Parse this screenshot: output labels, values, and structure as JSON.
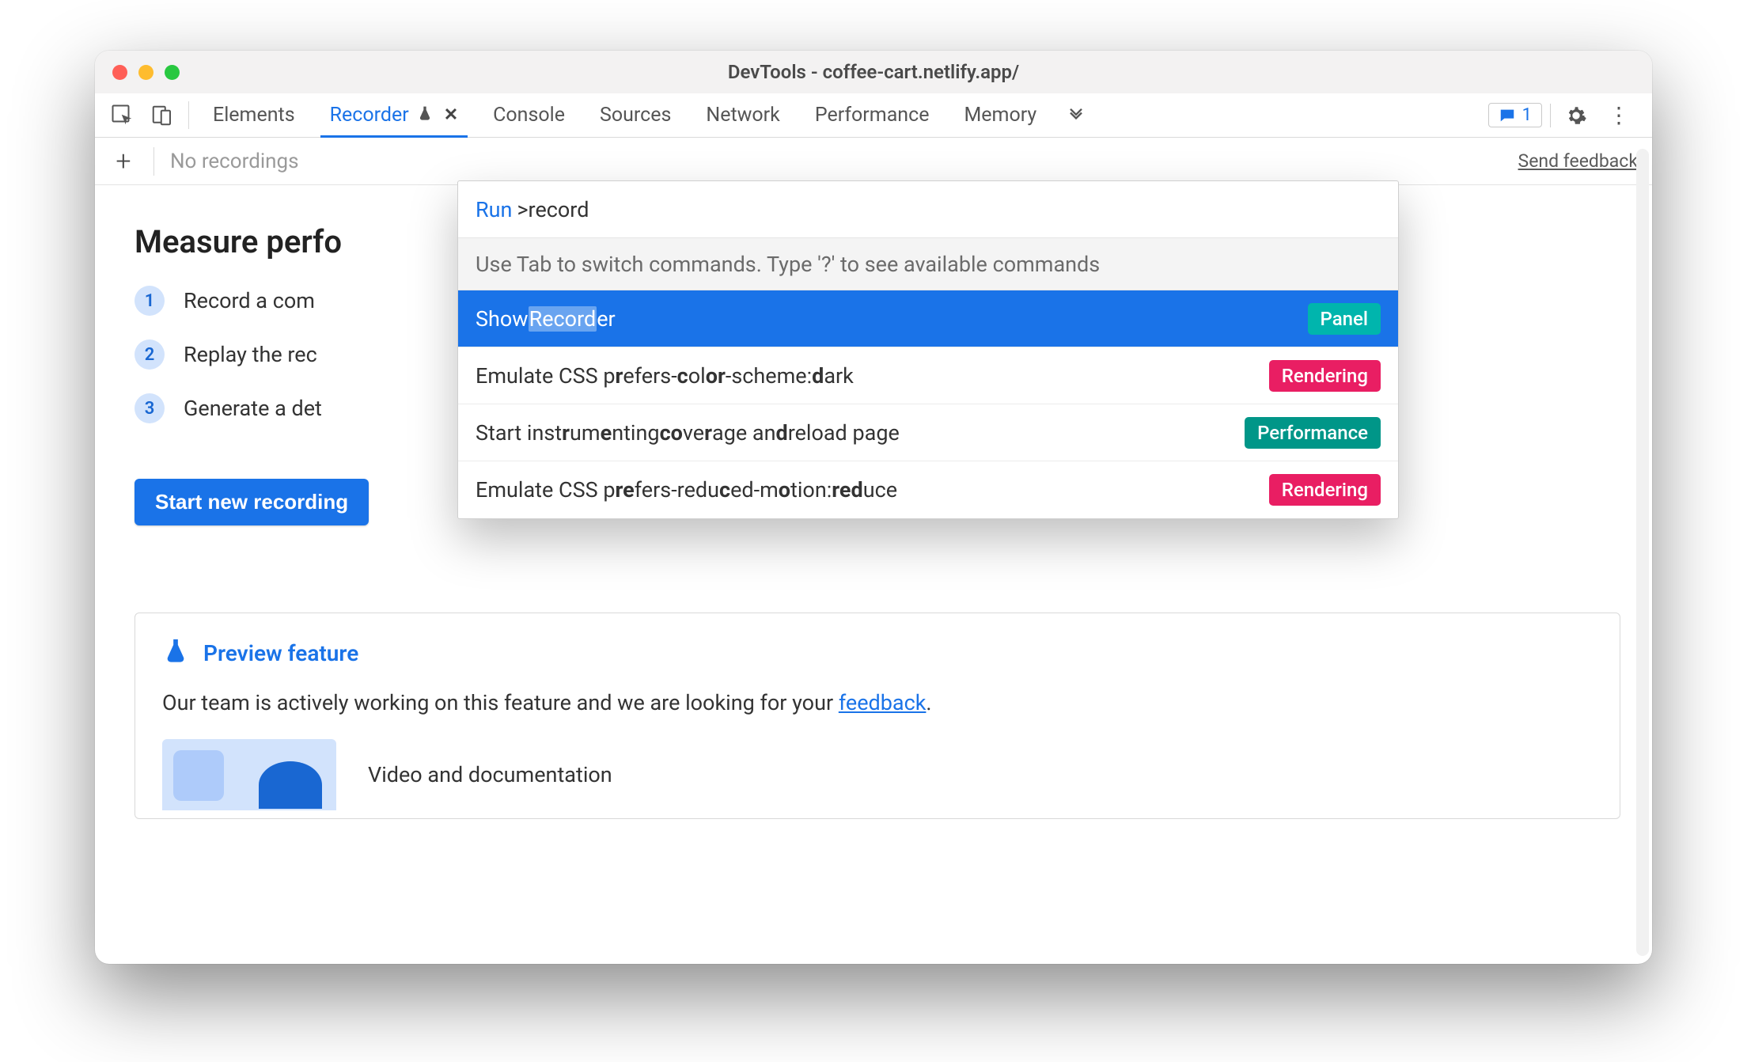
{
  "window": {
    "title": "DevTools - coffee-cart.netlify.app/"
  },
  "tabs": {
    "items": [
      "Elements",
      "Recorder",
      "Console",
      "Sources",
      "Network",
      "Performance",
      "Memory"
    ],
    "active_index": 1,
    "messages_count": "1"
  },
  "subbar": {
    "placeholder": "No recordings",
    "feedback_label": "Send feedback"
  },
  "content": {
    "heading_visible": "Measure perfo",
    "steps_visible": [
      "Record a com",
      "Replay the rec",
      "Generate a det"
    ],
    "start_button": "Start new recording"
  },
  "preview": {
    "title": "Preview feature",
    "body_prefix": "Our team is actively working on this feature and we are looking for your ",
    "body_link": "feedback",
    "body_suffix": ".",
    "media_title": "Video and documentation"
  },
  "palette": {
    "run_label": "Run",
    "query": ">record",
    "hint": "Use Tab to switch commands. Type '?' to see available commands",
    "items": [
      {
        "html": "Show <span class='hl'>Record</span>er",
        "badge": "Panel",
        "badge_class": "panel",
        "selected": true
      },
      {
        "html": "Emulate CSS p<b>r</b>efers-<b>c</b>ol<b>or</b>-scheme: <b>d</b>ark",
        "badge": "Rendering",
        "badge_class": "pink",
        "selected": false
      },
      {
        "html": "Start inst<b>r</b>um<b>e</b>nting <b>co</b>ve<b>r</b>age an<b>d</b> reload page",
        "badge": "Performance",
        "badge_class": "perf",
        "selected": false
      },
      {
        "html": "Emulate CSS p<b>re</b>fers-redu<b>c</b>ed-m<b>o</b>tion: <b>red</b>uce",
        "badge": "Rendering",
        "badge_class": "pink",
        "selected": false
      }
    ]
  }
}
